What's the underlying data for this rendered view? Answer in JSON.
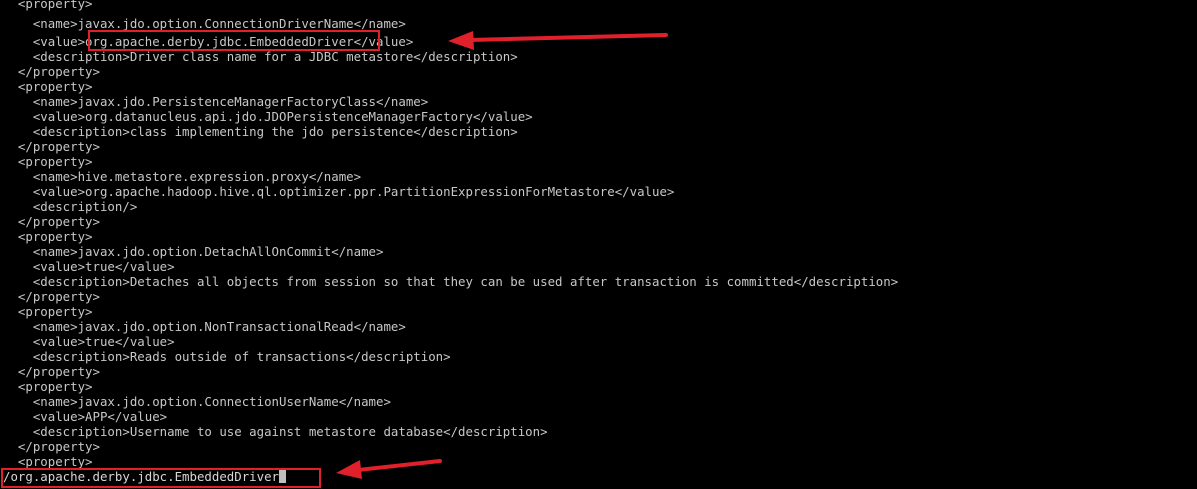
{
  "terminal": {
    "lines": [
      "  <property>",
      "    <name>javax.jdo.option.ConnectionDriverName</name>",
      "    <value>org.apache.derby.jdbc.EmbeddedDriver</value>",
      "    <description>Driver class name for a JDBC metastore</description>",
      "  </property>",
      "  <property>",
      "    <name>javax.jdo.PersistenceManagerFactoryClass</name>",
      "    <value>org.datanucleus.api.jdo.JDOPersistenceManagerFactory</value>",
      "    <description>class implementing the jdo persistence</description>",
      "  </property>",
      "  <property>",
      "    <name>hive.metastore.expression.proxy</name>",
      "    <value>org.apache.hadoop.hive.ql.optimizer.ppr.PartitionExpressionForMetastore</value>",
      "    <description/>",
      "  </property>",
      "  <property>",
      "    <name>javax.jdo.option.DetachAllOnCommit</name>",
      "    <value>true</value>",
      "    <description>Detaches all objects from session so that they can be used after transaction is committed</description>",
      "  </property>",
      "  <property>",
      "    <name>javax.jdo.option.NonTransactionalRead</name>",
      "    <value>true</value>",
      "    <description>Reads outside of transactions</description>",
      "  </property>",
      "  <property>",
      "    <name>javax.jdo.option.ConnectionUserName</name>",
      "    <value>APP</value>",
      "    <description>Username to use against metastore database</description>",
      "  </property>",
      "  <property>"
    ],
    "search_command": "/org.apache.derby.jdbc.EmbeddedDriver"
  },
  "colors": {
    "background": "#000000",
    "text": "#c7c7c7",
    "annotation": "#e0202a"
  }
}
